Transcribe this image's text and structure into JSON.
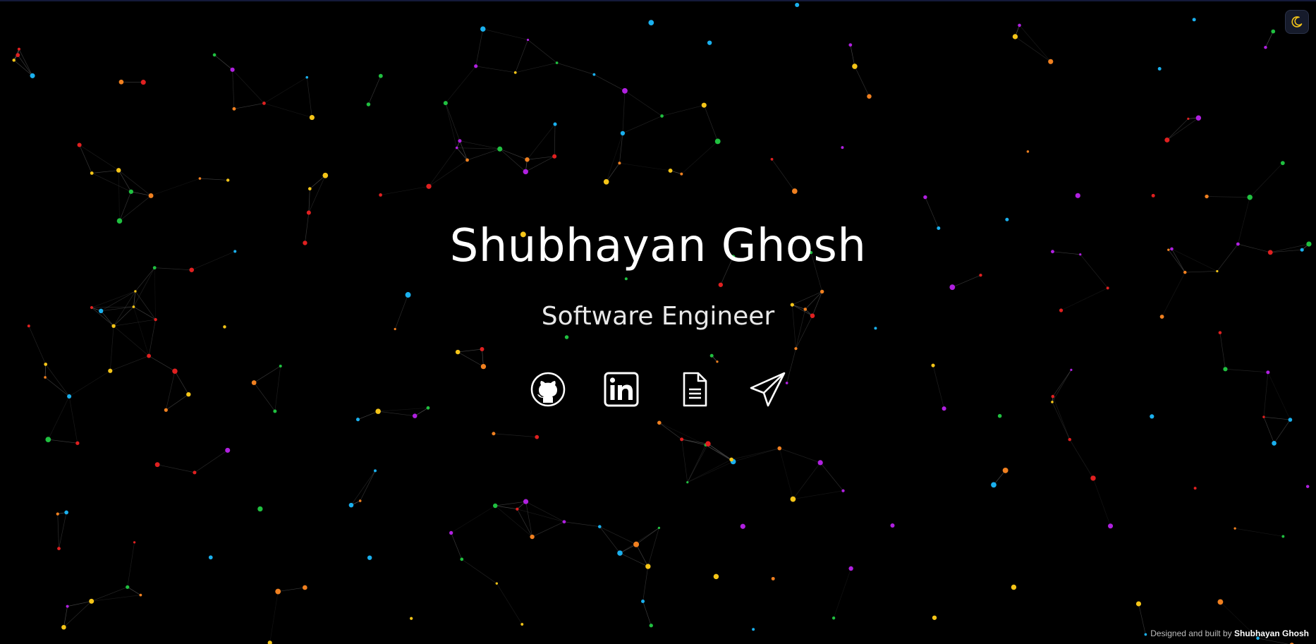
{
  "hero": {
    "name": "Shubhayan Ghosh",
    "role": "Software Engineer"
  },
  "socials": [
    {
      "name": "github",
      "icon": "github-icon"
    },
    {
      "name": "linkedin",
      "icon": "linkedin-icon"
    },
    {
      "name": "resume",
      "icon": "document-icon"
    },
    {
      "name": "contact",
      "icon": "paper-plane-icon"
    }
  ],
  "theme_toggle": {
    "icon": "moon-icon",
    "icon_color": "#f5c518"
  },
  "footer": {
    "prefix": "Designed and built by",
    "author": "Shubhayan Ghosh"
  },
  "colors": {
    "background": "#000000",
    "particle_palette": [
      "#e02020",
      "#f5c518",
      "#1ab0ee",
      "#b020e0",
      "#20c040",
      "#f08020"
    ],
    "link_line": "#6a6a6a"
  }
}
